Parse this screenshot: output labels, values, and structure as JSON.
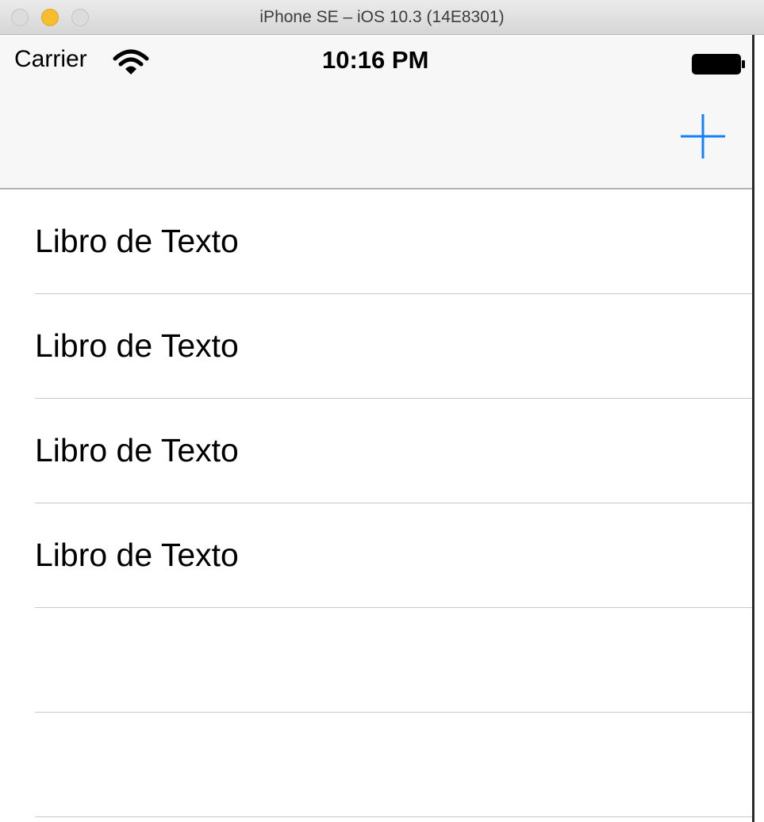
{
  "window": {
    "title": "iPhone SE – iOS 10.3 (14E8301)"
  },
  "status_bar": {
    "carrier": "Carrier",
    "time": "10:16 PM",
    "wifi_icon": "wifi-icon",
    "battery_icon": "battery-icon"
  },
  "nav_bar": {
    "add_icon": "plus-icon",
    "accent_color": "#147efb"
  },
  "table": {
    "rows": [
      {
        "label": "Libro de Texto"
      },
      {
        "label": "Libro de Texto"
      },
      {
        "label": "Libro de Texto"
      },
      {
        "label": "Libro de Texto"
      },
      {
        "label": ""
      },
      {
        "label": ""
      }
    ]
  }
}
